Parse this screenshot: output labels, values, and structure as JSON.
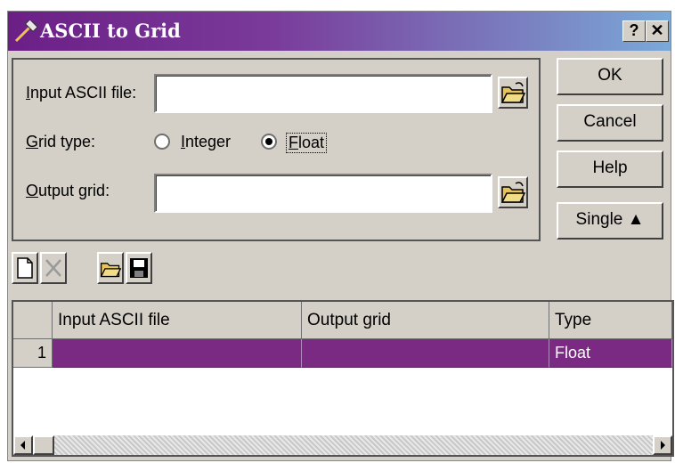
{
  "window": {
    "title": "ASCII to Grid",
    "help_glyph": "?",
    "close_glyph": "✕"
  },
  "form": {
    "input_label_pre": "",
    "input_label_u": "I",
    "input_label_rest": "nput ASCII file:",
    "input_value": "",
    "gridtype_label_u": "G",
    "gridtype_label_rest": "rid type:",
    "radio_integer_u": "I",
    "radio_integer_rest": "nteger",
    "radio_float_u": "F",
    "radio_float_rest": "loat",
    "selected_type": "Float",
    "output_label_u": "O",
    "output_label_rest": "utput grid:",
    "output_value": ""
  },
  "buttons": {
    "ok": "OK",
    "cancel": "Cancel",
    "help": "Help",
    "single": "Single ▲"
  },
  "toolbar": [
    "new-icon",
    "delete-icon",
    "open-icon",
    "save-icon"
  ],
  "table": {
    "columns": [
      "",
      "Input ASCII file",
      "Output grid",
      "Type"
    ],
    "rows": [
      {
        "num": "1",
        "input": "",
        "output": "",
        "type": "Float"
      }
    ]
  },
  "colors": {
    "title_start": "#6b1f86",
    "selected_row": "#7b2a84",
    "face": "#d4d0c8"
  }
}
